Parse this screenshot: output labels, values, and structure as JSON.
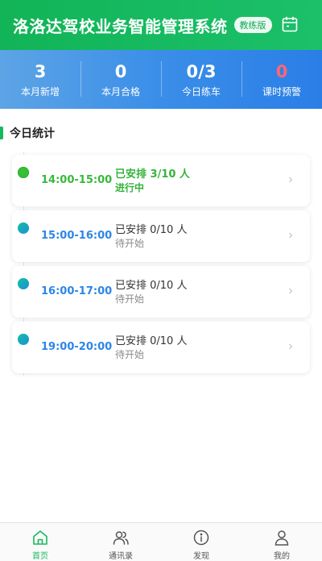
{
  "header": {
    "title": "洛洛达驾校业务智能管理系统",
    "badge": "教练版",
    "calendar_icon": "calendar-icon"
  },
  "stats": [
    {
      "value": "3",
      "label": "本月新增"
    },
    {
      "value": "0",
      "label": "本月合格"
    },
    {
      "value": "0/3",
      "label": "今日练车"
    },
    {
      "value": "0",
      "label": "课时预警",
      "color": "#ff6672"
    }
  ],
  "section": {
    "title": "今日统计"
  },
  "schedule": [
    {
      "time": "14:00-15:00",
      "arranged": "已安排 3/10 人",
      "status": "进行中",
      "state": "active"
    },
    {
      "time": "15:00-16:00",
      "arranged": "已安排 0/10 人",
      "status": "待开始",
      "state": "pending"
    },
    {
      "time": "16:00-17:00",
      "arranged": "已安排 0/10 人",
      "status": "待开始",
      "state": "pending"
    },
    {
      "time": "19:00-20:00",
      "arranged": "已安排 0/10 人",
      "status": "待开始",
      "state": "pending"
    }
  ],
  "tabs": [
    {
      "label": "首页",
      "icon": "home-icon",
      "active": true
    },
    {
      "label": "通讯录",
      "icon": "contacts-icon",
      "active": false
    },
    {
      "label": "发现",
      "icon": "discover-icon",
      "active": false
    },
    {
      "label": "我的",
      "icon": "profile-icon",
      "active": false
    }
  ],
  "colors": {
    "brand_green": "#17b95e",
    "stats_blue": "#3a8ee8",
    "active_green": "#37b83c",
    "pending_blue": "#2c86e6",
    "warning_red": "#ff6672"
  }
}
